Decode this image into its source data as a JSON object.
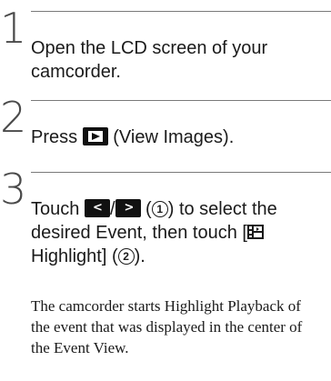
{
  "steps": [
    {
      "number": "1",
      "text": "Open the LCD screen of your camcorder."
    },
    {
      "number": "2",
      "text_before": "Press",
      "text_after": "(View Images)."
    },
    {
      "number": "3",
      "text_before": "Touch",
      "slash": "/",
      "marker_1": "1",
      "line_mid": "to select the desired Event, then touch",
      "highlight_label": "Highlight",
      "marker_2": "2",
      "end": ").",
      "note": "The camcorder starts Highlight Playback of the event that was displayed in the center of the Event View."
    }
  ],
  "icons": {
    "play": "view-images-icon",
    "prev": "previous-event-icon",
    "next": "next-event-icon",
    "highlight": "highlight-film-icon"
  }
}
